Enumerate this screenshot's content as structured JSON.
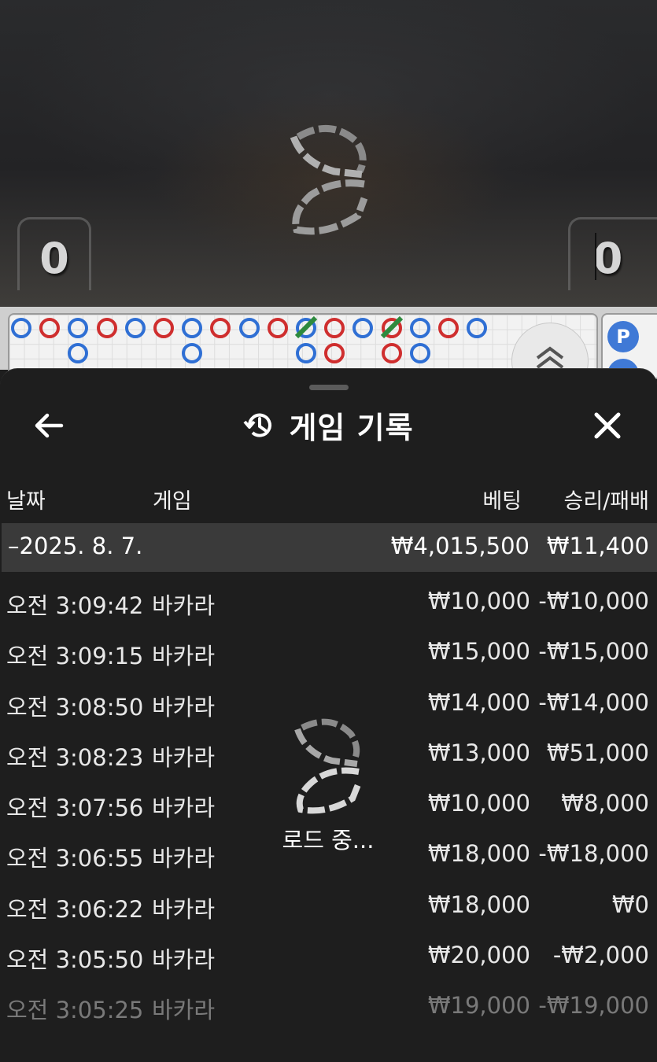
{
  "video": {
    "player_score": "0",
    "banker_score": "0"
  },
  "road": {
    "side_badge": "P",
    "colors": {
      "player": "#2f6fd4",
      "banker": "#cf2e2e",
      "tie": "#2e8a3e"
    }
  },
  "sheet": {
    "title": "게임 기록",
    "back_icon": "arrow-left-icon",
    "history_icon": "history-icon",
    "close_icon": "close-icon"
  },
  "columns": {
    "date": "날짜",
    "game": "게임",
    "bet": "베팅",
    "win_loss": "승리/패배"
  },
  "group": {
    "date": "–2025. 8. 7.",
    "bet_total": "₩4,015,500",
    "win_loss_total": "₩11,400"
  },
  "rows": [
    {
      "time": "오전 3:09:42",
      "game": "바카라",
      "bet": "₩10,000",
      "win_loss": "-₩10,000"
    },
    {
      "time": "오전 3:09:15",
      "game": "바카라",
      "bet": "₩15,000",
      "win_loss": "-₩15,000"
    },
    {
      "time": "오전 3:08:50",
      "game": "바카라",
      "bet": "₩14,000",
      "win_loss": "-₩14,000"
    },
    {
      "time": "오전 3:08:23",
      "game": "바카라",
      "bet": "₩13,000",
      "win_loss": "₩51,000"
    },
    {
      "time": "오전 3:07:56",
      "game": "바카라",
      "bet": "₩10,000",
      "win_loss": "₩8,000"
    },
    {
      "time": "오전 3:06:55",
      "game": "바카라",
      "bet": "₩18,000",
      "win_loss": "-₩18,000"
    },
    {
      "time": "오전 3:06:22",
      "game": "바카라",
      "bet": "₩18,000",
      "win_loss": "₩0"
    },
    {
      "time": "오전 3:05:50",
      "game": "바카라",
      "bet": "₩20,000",
      "win_loss": "-₩2,000"
    },
    {
      "time": "오전 3:05:25",
      "game": "바카라",
      "bet": "₩19,000",
      "win_loss": "-₩19,000"
    }
  ],
  "loading": {
    "text": "로드 중..."
  }
}
